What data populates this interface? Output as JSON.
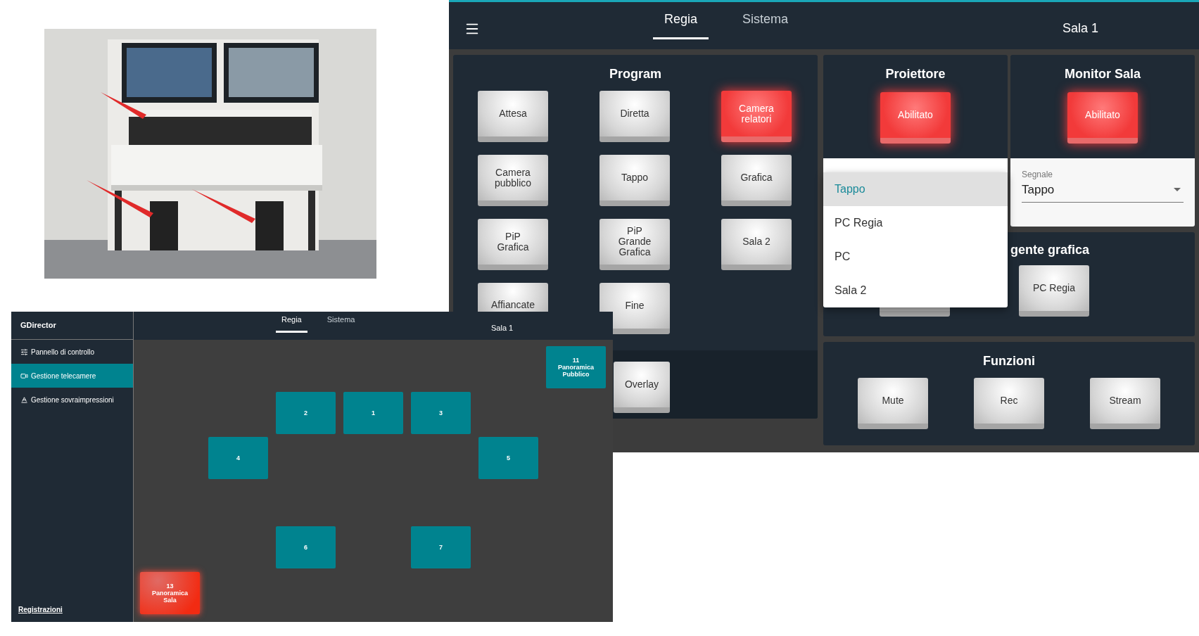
{
  "regia_window": {
    "tabs": [
      {
        "label": "Regia",
        "selected": true
      },
      {
        "label": "Sistema",
        "selected": false
      }
    ],
    "room": "Sala 1",
    "program": {
      "title": "Program",
      "buttons": [
        {
          "label": "Attesa",
          "active": false
        },
        {
          "label": "Diretta",
          "active": false
        },
        {
          "label": "Camera relatori",
          "active": true
        },
        {
          "label": "Camera pubblico",
          "active": false
        },
        {
          "label": "Tappo",
          "active": false
        },
        {
          "label": "Grafica",
          "active": false
        },
        {
          "label": "PiP Grafica",
          "active": false
        },
        {
          "label": "PiP Grande Grafica",
          "active": false
        },
        {
          "label": "Sala 2",
          "active": false
        },
        {
          "label": "Affiancate",
          "active": false
        },
        {
          "label": "Fine",
          "active": false
        }
      ],
      "overlay_button": {
        "label": "Overlay",
        "active": false
      }
    },
    "proiettore": {
      "title": "Proiettore",
      "button": {
        "label": "Abilitato",
        "active": true
      }
    },
    "monitor_sala": {
      "title": "Monitor Sala",
      "button": {
        "label": "Abilitato",
        "active": true
      },
      "select": {
        "label": "Segnale",
        "value": "Tappo"
      }
    },
    "signal_menu": {
      "options": [
        {
          "label": "Tappo",
          "selected": true
        },
        {
          "label": "PC Regia",
          "selected": false
        },
        {
          "label": "PC",
          "selected": false
        },
        {
          "label": "Sala 2",
          "selected": false
        }
      ]
    },
    "sorgente_grafica": {
      "title": "gente grafica",
      "buttons": [
        {
          "label": "PC Regia",
          "active": false
        }
      ]
    },
    "funzioni": {
      "title": "Funzioni",
      "buttons": [
        {
          "label": "Mute",
          "active": false
        },
        {
          "label": "Rec",
          "active": false
        },
        {
          "label": "Stream",
          "active": false
        }
      ]
    }
  },
  "director_window": {
    "app_title": "GDirector",
    "sidebar": {
      "items": [
        {
          "label": "Pannello di controllo",
          "selected": false
        },
        {
          "label": "Gestione telecamere",
          "selected": true
        },
        {
          "label": "Gestione sovraimpressioni",
          "selected": false
        }
      ],
      "footer_link": "Registrazioni"
    },
    "tabs": [
      {
        "label": "Regia",
        "selected": true
      },
      {
        "label": "Sistema",
        "selected": false
      }
    ],
    "room": "Sala 1",
    "cameras": [
      {
        "number": "2",
        "active": false
      },
      {
        "number": "1",
        "active": false
      },
      {
        "number": "3",
        "active": false
      },
      {
        "number": "4",
        "active": false
      },
      {
        "number": "5",
        "active": false
      },
      {
        "number": "6",
        "active": false
      },
      {
        "number": "7",
        "active": false
      },
      {
        "number": "11",
        "name": "Panoramica Pubblico",
        "active": false
      },
      {
        "number": "13",
        "name": "Panoramica Sala",
        "active": true
      }
    ]
  }
}
